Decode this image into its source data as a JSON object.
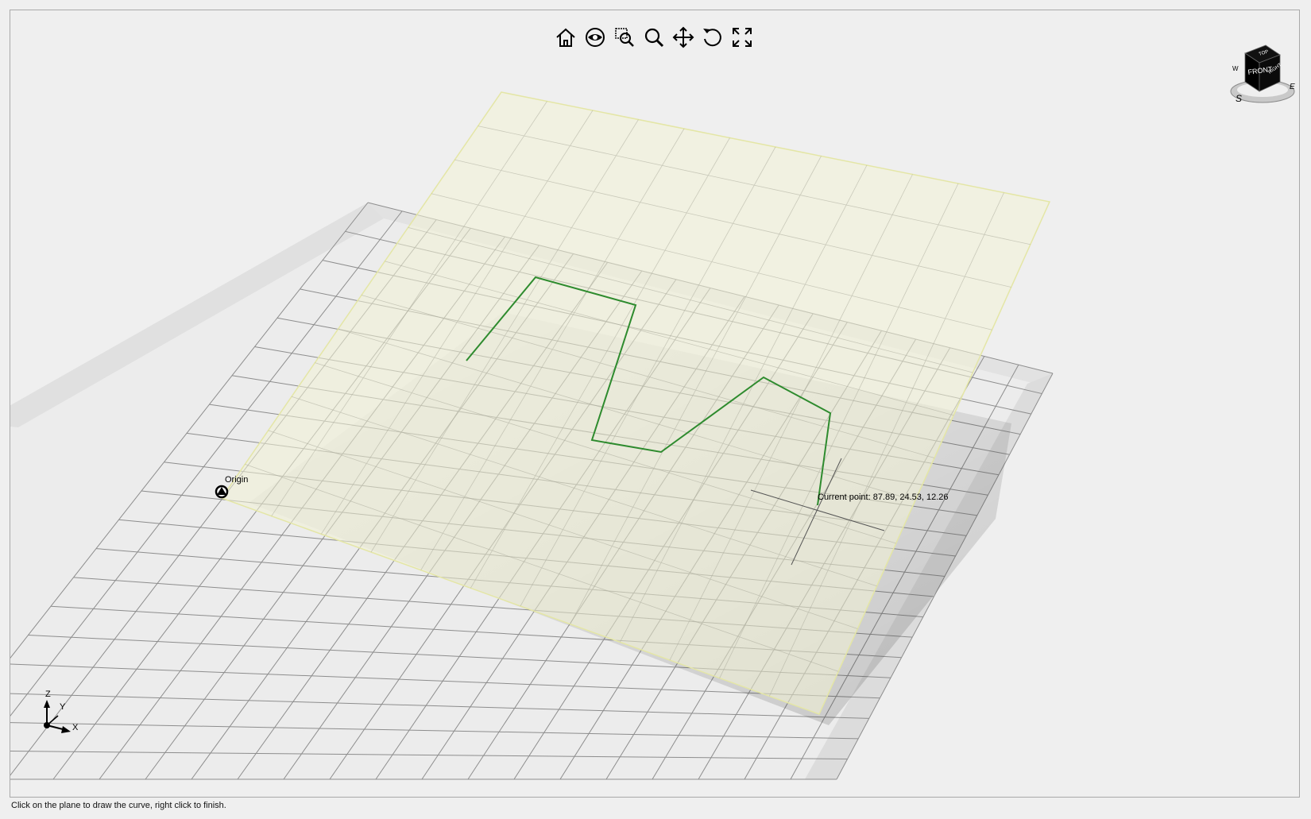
{
  "toolbar": {
    "buttons": [
      {
        "name": "home-view-button",
        "icon": "home-icon"
      },
      {
        "name": "look-around-button",
        "icon": "eye-icon"
      },
      {
        "name": "zoom-window-button",
        "icon": "zoom-window-icon"
      },
      {
        "name": "zoom-button",
        "icon": "magnifier-icon"
      },
      {
        "name": "pan-button",
        "icon": "move-arrows-icon"
      },
      {
        "name": "orbit-button",
        "icon": "rotate-icon"
      },
      {
        "name": "fit-all-button",
        "icon": "fullscreen-icon"
      }
    ]
  },
  "viewcube": {
    "face_front": "FRONT",
    "face_top": "TOP",
    "face_right": "RIGHT",
    "compass_s": "S",
    "compass_e": "E",
    "compass_w": "W"
  },
  "scene": {
    "origin_label": "Origin",
    "cursor_readout": "Current point: 87.89, 24.53, 12.26",
    "curve_color": "#2e8b2e",
    "plane_color": "#f4f4d8"
  },
  "axis_triad": {
    "x": "X",
    "y": "Y",
    "z": "Z"
  },
  "status": {
    "message": "Click on the plane to draw the curve, right click to finish."
  }
}
